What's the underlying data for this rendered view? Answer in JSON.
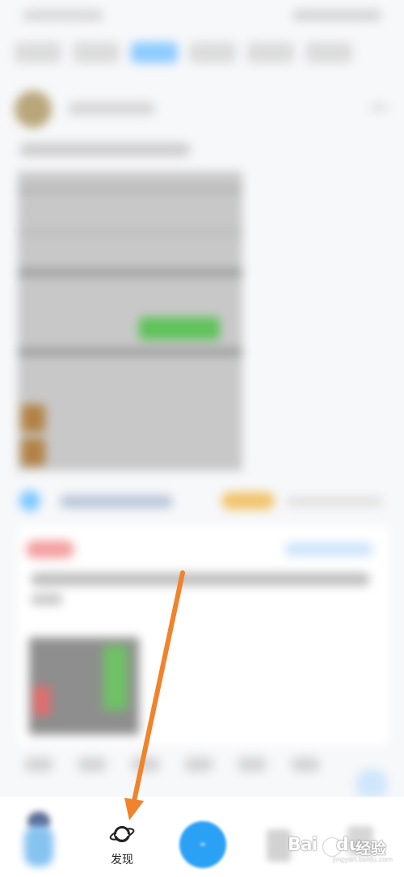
{
  "bottom_nav": {
    "discover_label": "发现",
    "discover_icon": "planet-icon"
  },
  "watermark": {
    "brand": "Bai",
    "brand_suffix": "du",
    "product": "经验",
    "url": "jingyan.baidu.com"
  },
  "annotation": {
    "arrow_color": "#f0832b"
  },
  "colors": {
    "accent": "#2ba1f5",
    "active_tab": "#8ecbff"
  }
}
